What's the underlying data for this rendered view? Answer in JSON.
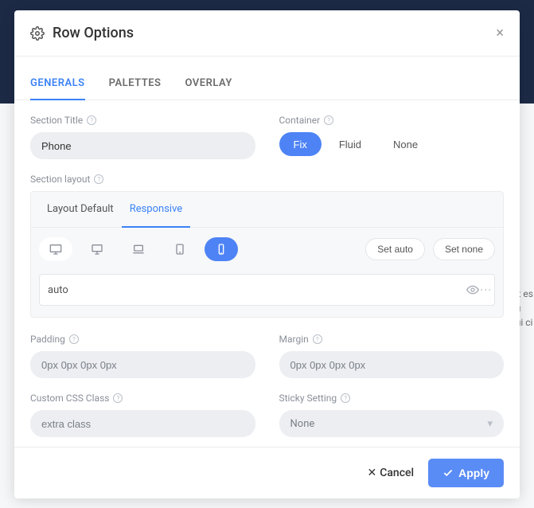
{
  "modal": {
    "title": "Row Options",
    "close": "×"
  },
  "tabs": [
    "GENERALS",
    "PALETTES",
    "OVERLAY"
  ],
  "fields": {
    "section_title_label": "Section Title",
    "section_title_value": "Phone",
    "container_label": "Container",
    "container_options": [
      "Fix",
      "Fluid",
      "None"
    ],
    "section_layout_label": "Section layout",
    "layout_tabs": [
      "Layout Default",
      "Responsive"
    ],
    "devices": [
      "desktop-wide",
      "desktop",
      "laptop",
      "tablet",
      "phone"
    ],
    "set_auto": "Set auto",
    "set_none": "Set none",
    "auto_value": "auto",
    "padding_label": "Padding",
    "padding_placeholder": "0px 0px 0px 0px",
    "margin_label": "Margin",
    "margin_placeholder": "0px 0px 0px 0px",
    "css_label": "Custom CSS Class",
    "css_placeholder": "extra class",
    "sticky_label": "Sticky Setting",
    "sticky_value": "None"
  },
  "footer": {
    "cancel": "Cancel",
    "apply": "Apply"
  }
}
